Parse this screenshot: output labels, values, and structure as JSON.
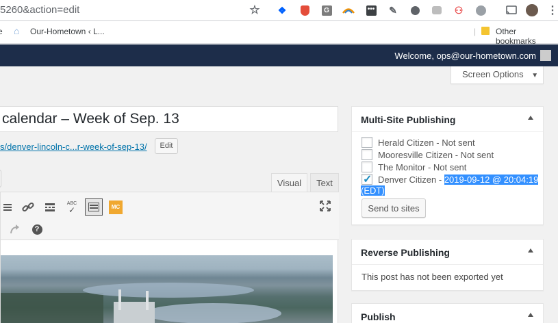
{
  "browser": {
    "url": "5260&action=edit",
    "bookmark_site": "Our-Hometown ‹ L...",
    "other_bookmarks": "Other bookmarks"
  },
  "adminbar": {
    "welcome": "Welcome, ops@our-hometown.com"
  },
  "screen_options": {
    "label": "Screen Options"
  },
  "post": {
    "title": "calendar – Week of Sep. 13",
    "permalink": "s/denver-lincoln-c...r-week-of-sep-13/",
    "edit_label": "Edit"
  },
  "editor": {
    "tabs": [
      {
        "label": "Visual",
        "active": true
      },
      {
        "label": "Text",
        "active": false
      }
    ],
    "abc_label": "ABC",
    "mc_label": "MC"
  },
  "multisite": {
    "title": "Multi-Site Publishing",
    "sites": [
      {
        "label": "Herald Citizen - Not sent",
        "checked": false
      },
      {
        "label": "Mooresville Citizen - Not sent",
        "checked": false
      },
      {
        "label": "The Monitor - Not sent",
        "checked": false
      },
      {
        "label": "Denver Citizen - ",
        "checked": true
      }
    ],
    "selected_date": "2019-09-12 @ 20:04:19",
    "selected_tz": "(EDT)",
    "send_label": "Send to sites"
  },
  "reverse": {
    "title": "Reverse Publishing",
    "message": "This post has not been exported yet"
  },
  "publish": {
    "title": "Publish"
  },
  "colors": {
    "adminbar": "#1d2d4a",
    "link": "#0073aa",
    "selection": "#3390ff",
    "checkmark": "#1e8cbe"
  }
}
